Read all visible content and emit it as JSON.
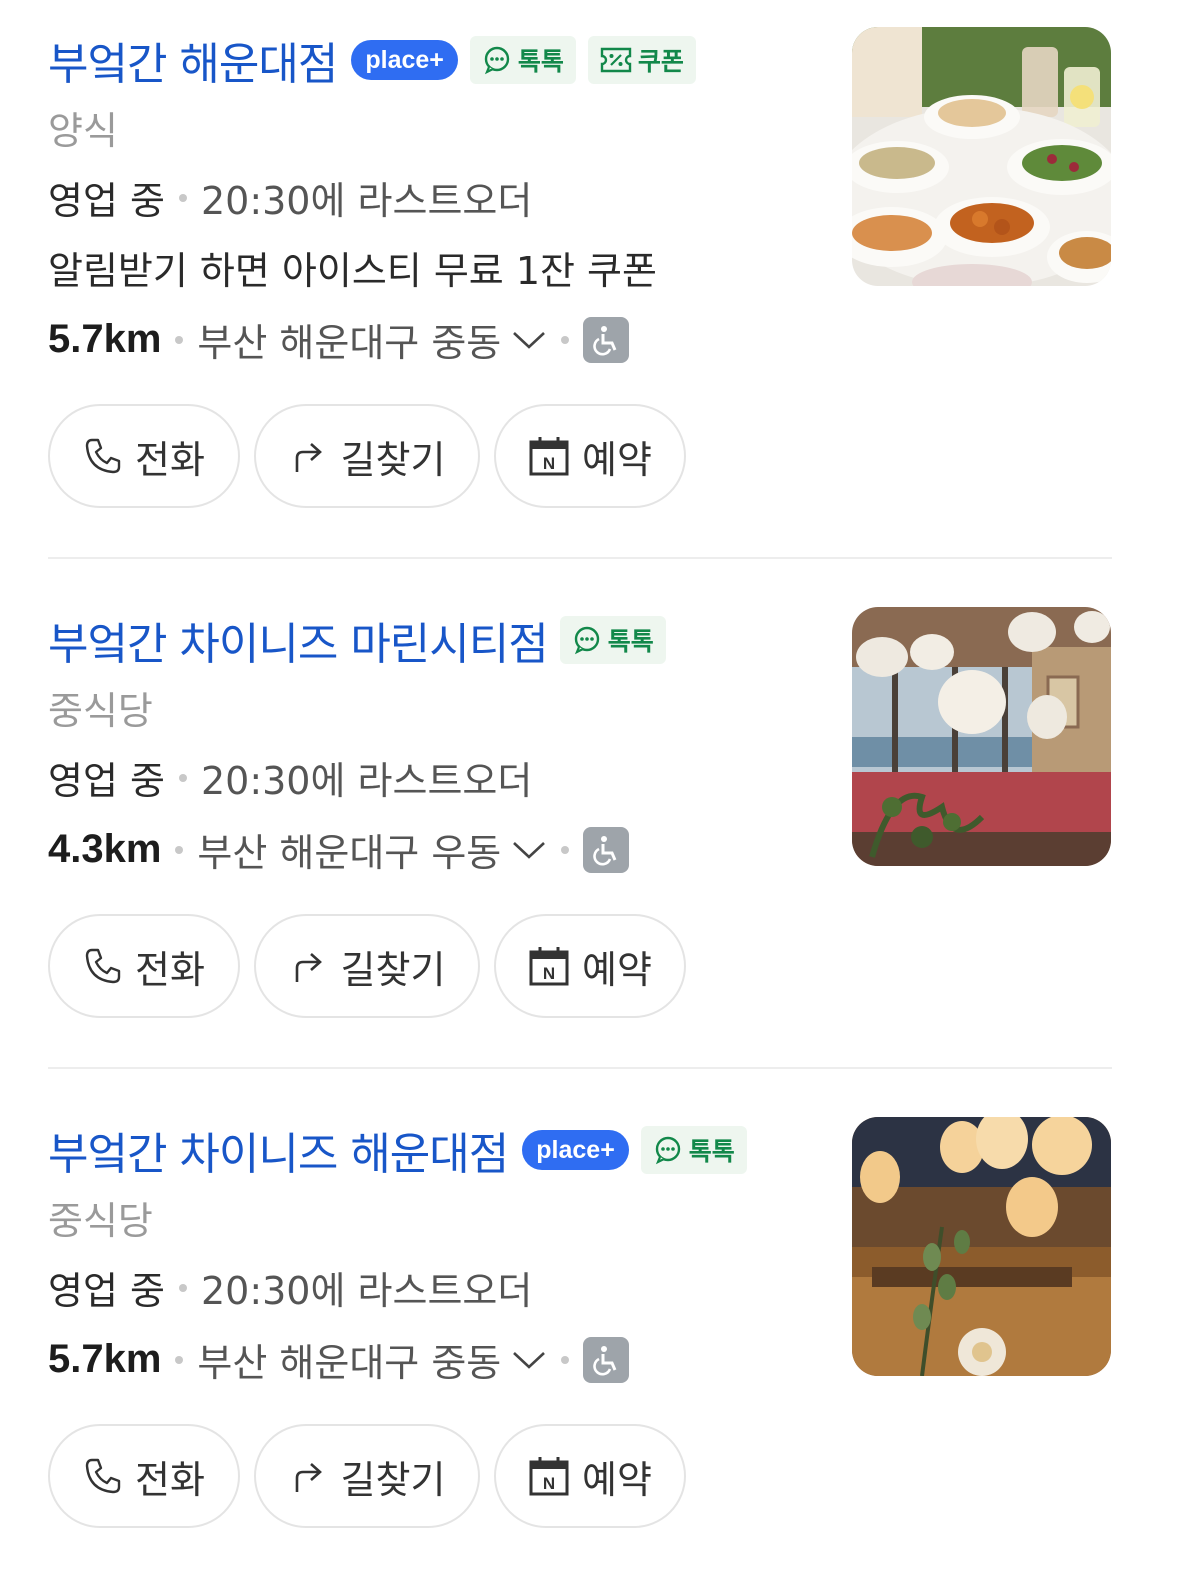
{
  "places": [
    {
      "name": "부엌간 해운대점",
      "badges": {
        "place_plus": "place+",
        "talk": "톡톡",
        "coupon": "쿠폰"
      },
      "category": "양식",
      "status": "영업 중",
      "last_order": "20:30에 라스트오더",
      "promo": "알림받기 하면 아이스티 무료 1잔 쿠폰",
      "distance": "5.7km",
      "address": "부산 해운대구 중동",
      "photo": "food-table-photo"
    },
    {
      "name": "부엌간 차이니즈 마린시티점",
      "badges": {
        "talk": "톡톡"
      },
      "category": "중식당",
      "status": "영업 중",
      "last_order": "20:30에 라스트오더",
      "distance": "4.3km",
      "address": "부산 해운대구 우동",
      "photo": "restaurant-interior-lamps-photo"
    },
    {
      "name": "부엌간 차이니즈 해운대점",
      "badges": {
        "place_plus": "place+",
        "talk": "톡톡"
      },
      "category": "중식당",
      "status": "영업 중",
      "last_order": "20:30에 라스트오더",
      "distance": "5.7km",
      "address": "부산 해운대구 중동",
      "photo": "restaurant-warm-interior-photo"
    }
  ],
  "actions": {
    "call": "전화",
    "route": "길찾기",
    "reserve": "예약"
  },
  "colors": {
    "title": "#1856c8",
    "place_plus": "#2f6df2",
    "talk_green": "#12884a"
  }
}
